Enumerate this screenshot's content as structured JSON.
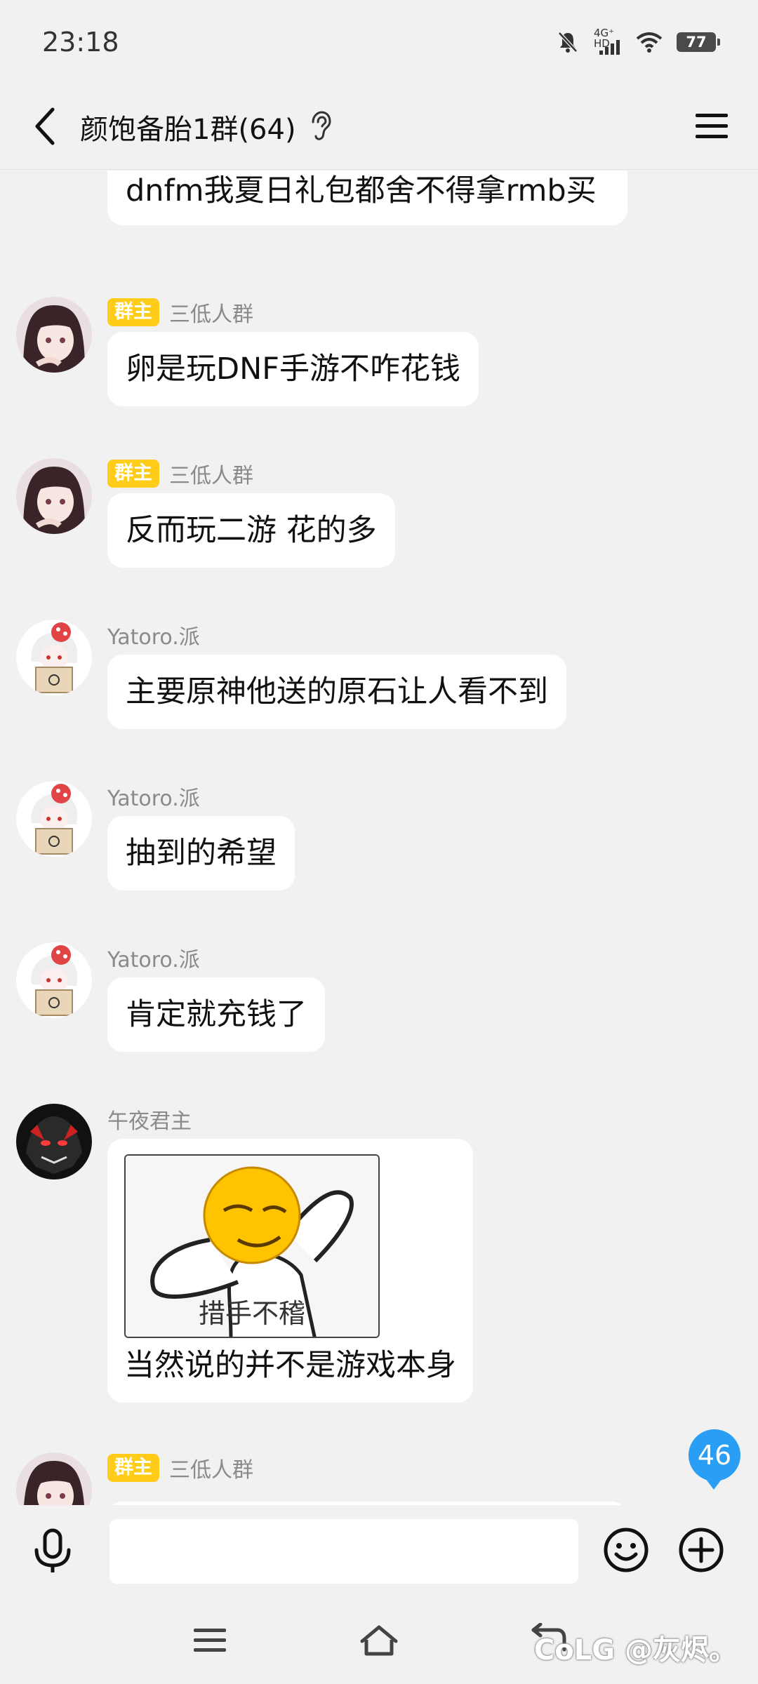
{
  "status_bar": {
    "time": "23:18",
    "network_label": "4G⁺ HD",
    "battery": "77"
  },
  "header": {
    "title": "颜饱备胎1群(64)"
  },
  "messages": [
    {
      "text": "dnfm我夏日礼包都舍不得拿rmb买"
    },
    {
      "badge": "群主",
      "sender": "三低人群",
      "text": "卵是玩DNF手游不咋花钱"
    },
    {
      "badge": "群主",
      "sender": "三低人群",
      "text": "反而玩二游 花的多"
    },
    {
      "sender": "Yatoro.派",
      "text": "主要原神他送的原石让人看不到"
    },
    {
      "sender": "Yatoro.派",
      "text": "抽到的希望"
    },
    {
      "sender": "Yatoro.派",
      "text": "肯定就充钱了"
    },
    {
      "sender": "午夜君主",
      "sticker_caption": "措手不稽",
      "text": "当然说的并不是游戏本身"
    },
    {
      "badge": "群主",
      "sender": "三低人群"
    }
  ],
  "unread_count": "46",
  "input": {
    "placeholder": ""
  },
  "watermark": "CoLG @灰烬。",
  "colors": {
    "owner_badge": "#ffcc1a",
    "unread_badge": "#2a9df4",
    "bubble": "#ffffff",
    "background": "#f1f1f1"
  },
  "icons": [
    "back-arrow-icon",
    "ear-icon",
    "menu-icon",
    "microphone-icon",
    "emoji-icon",
    "plus-icon",
    "nav-menu-icon",
    "nav-home-icon",
    "nav-back-icon",
    "notification-muted-icon",
    "signal-icon",
    "wifi-icon",
    "battery-icon"
  ]
}
